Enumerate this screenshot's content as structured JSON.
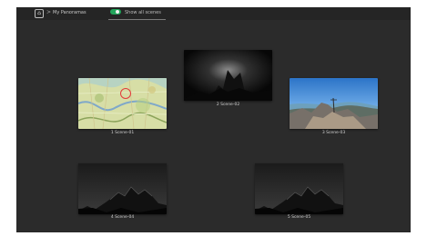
{
  "topbar": {
    "home_icon": "home-icon",
    "separator": ">",
    "breadcrumb": "My Panoramas",
    "toggle_label": "Show all scenes",
    "accent": "#22a55b"
  },
  "scenes": [
    {
      "caption": "1 Scene-01"
    },
    {
      "caption": "2 Scene-02"
    },
    {
      "caption": "3 Scene-03"
    },
    {
      "caption": "4 Scene-04"
    },
    {
      "caption": "5 Scene-05"
    }
  ]
}
